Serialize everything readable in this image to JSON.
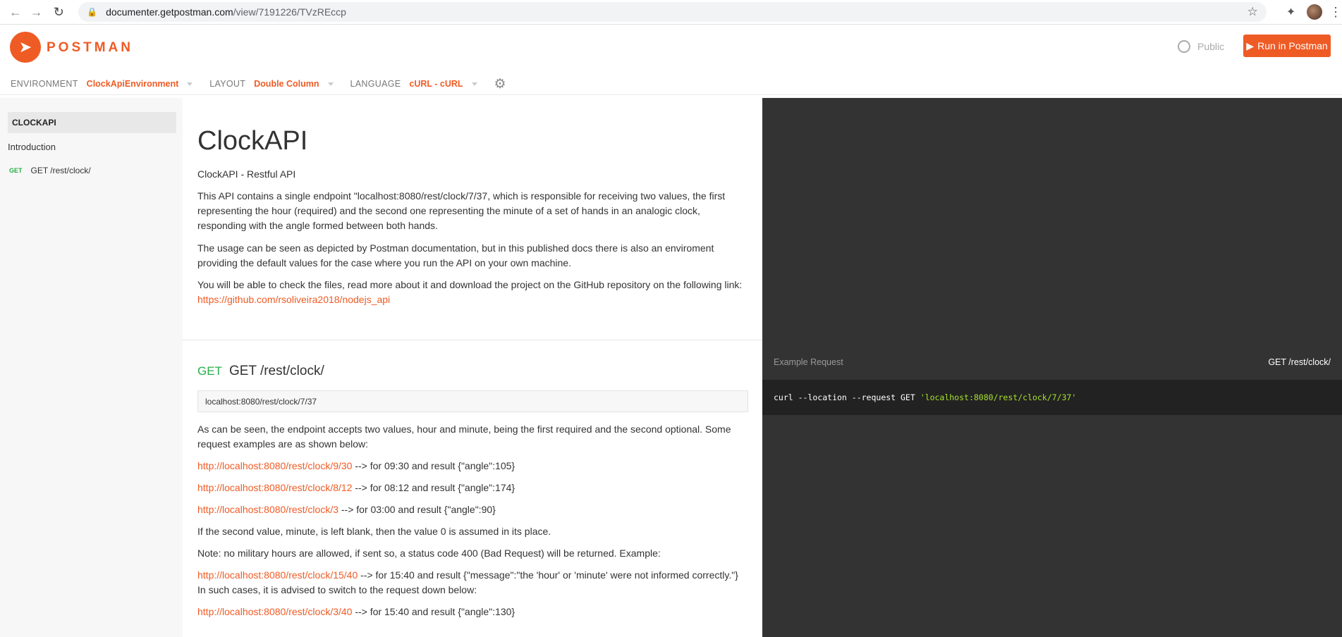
{
  "browser": {
    "url_host": "documenter.getpostman.com",
    "url_path": "/view/7191226/TVzREccp"
  },
  "header": {
    "logo_text": "POSTMAN",
    "public_label": "Public",
    "run_button_label": "Run in Postman",
    "environment_label": "ENVIRONMENT",
    "environment_value": "ClockApiEnvironment",
    "layout_label": "LAYOUT",
    "layout_value": "Double Column",
    "language_label": "LANGUAGE",
    "language_value": "cURL - cURL"
  },
  "sidebar": {
    "collection": "CLOCKAPI",
    "intro": "Introduction",
    "request_method": "GET",
    "request_label": "GET /rest/clock/"
  },
  "main": {
    "title": "ClockAPI",
    "subtitle": "ClockAPI - Restful API",
    "para1": "This API contains a single endpoint \"localhost:8080/rest/clock/7/37, which is responsible for receiving two values, the first representing the hour (required) and the second one representing the minute of a set of hands in an analogic clock, responding with the angle formed between both hands.",
    "para2": "The usage can be seen as depicted by Postman documentation, but in this published docs there is also an enviroment providing the default values for the case where you run the API on your own machine.",
    "para3_text": "You will be able to check the files, read more about it and download the project on the GitHub repository on the following link: ",
    "para3_link": "https://github.com/rsoliveira2018/nodejs_api",
    "endpoint_method": "GET",
    "endpoint_title": "GET /rest/clock/",
    "endpoint_url": "localhost:8080/rest/clock/7/37",
    "desc1": "As can be seen, the endpoint accepts two values, hour and minute, being the first required and the second optional. Some request examples are as shown below:",
    "ex1_link": "http://localhost:8080/rest/clock/9/30",
    "ex1_text": " --> for 09:30 and result {\"angle\":105}",
    "ex2_link": "http://localhost:8080/rest/clock/8/12",
    "ex2_text": " --> for 08:12 and result {\"angle\":174}",
    "ex3_link": "http://localhost:8080/rest/clock/3",
    "ex3_text": " --> for 03:00 and result {\"angle\":90}",
    "note1": "If the second value, minute, is left blank, then the value 0 is assumed in its place.",
    "note2": "Note: no military hours are allowed, if sent so, a status code 400 (Bad Request) will be returned. Example:",
    "ex4_link": "http://localhost:8080/rest/clock/15/40",
    "ex4_text": " --> for 15:40 and result {\"message\":\"the 'hour' or 'minute' were not informed correctly.\"} In such cases, it is advised to switch to the request down below:",
    "ex5_link": "http://localhost:8080/rest/clock/3/40",
    "ex5_text": " --> for 15:40 and result {\"angle\":130}"
  },
  "example": {
    "label": "Example Request",
    "endpoint": "GET /rest/clock/",
    "code_cmd": "curl --location --request GET ",
    "code_url": "'localhost:8080/rest/clock/7/37'"
  },
  "icons": [
    "back-arrow-icon",
    "forward-arrow-icon",
    "reload-icon",
    "lock-icon",
    "star-icon",
    "puzzle-icon",
    "globe-icon",
    "play-icon",
    "gear-icon",
    "postman-logo-icon"
  ]
}
